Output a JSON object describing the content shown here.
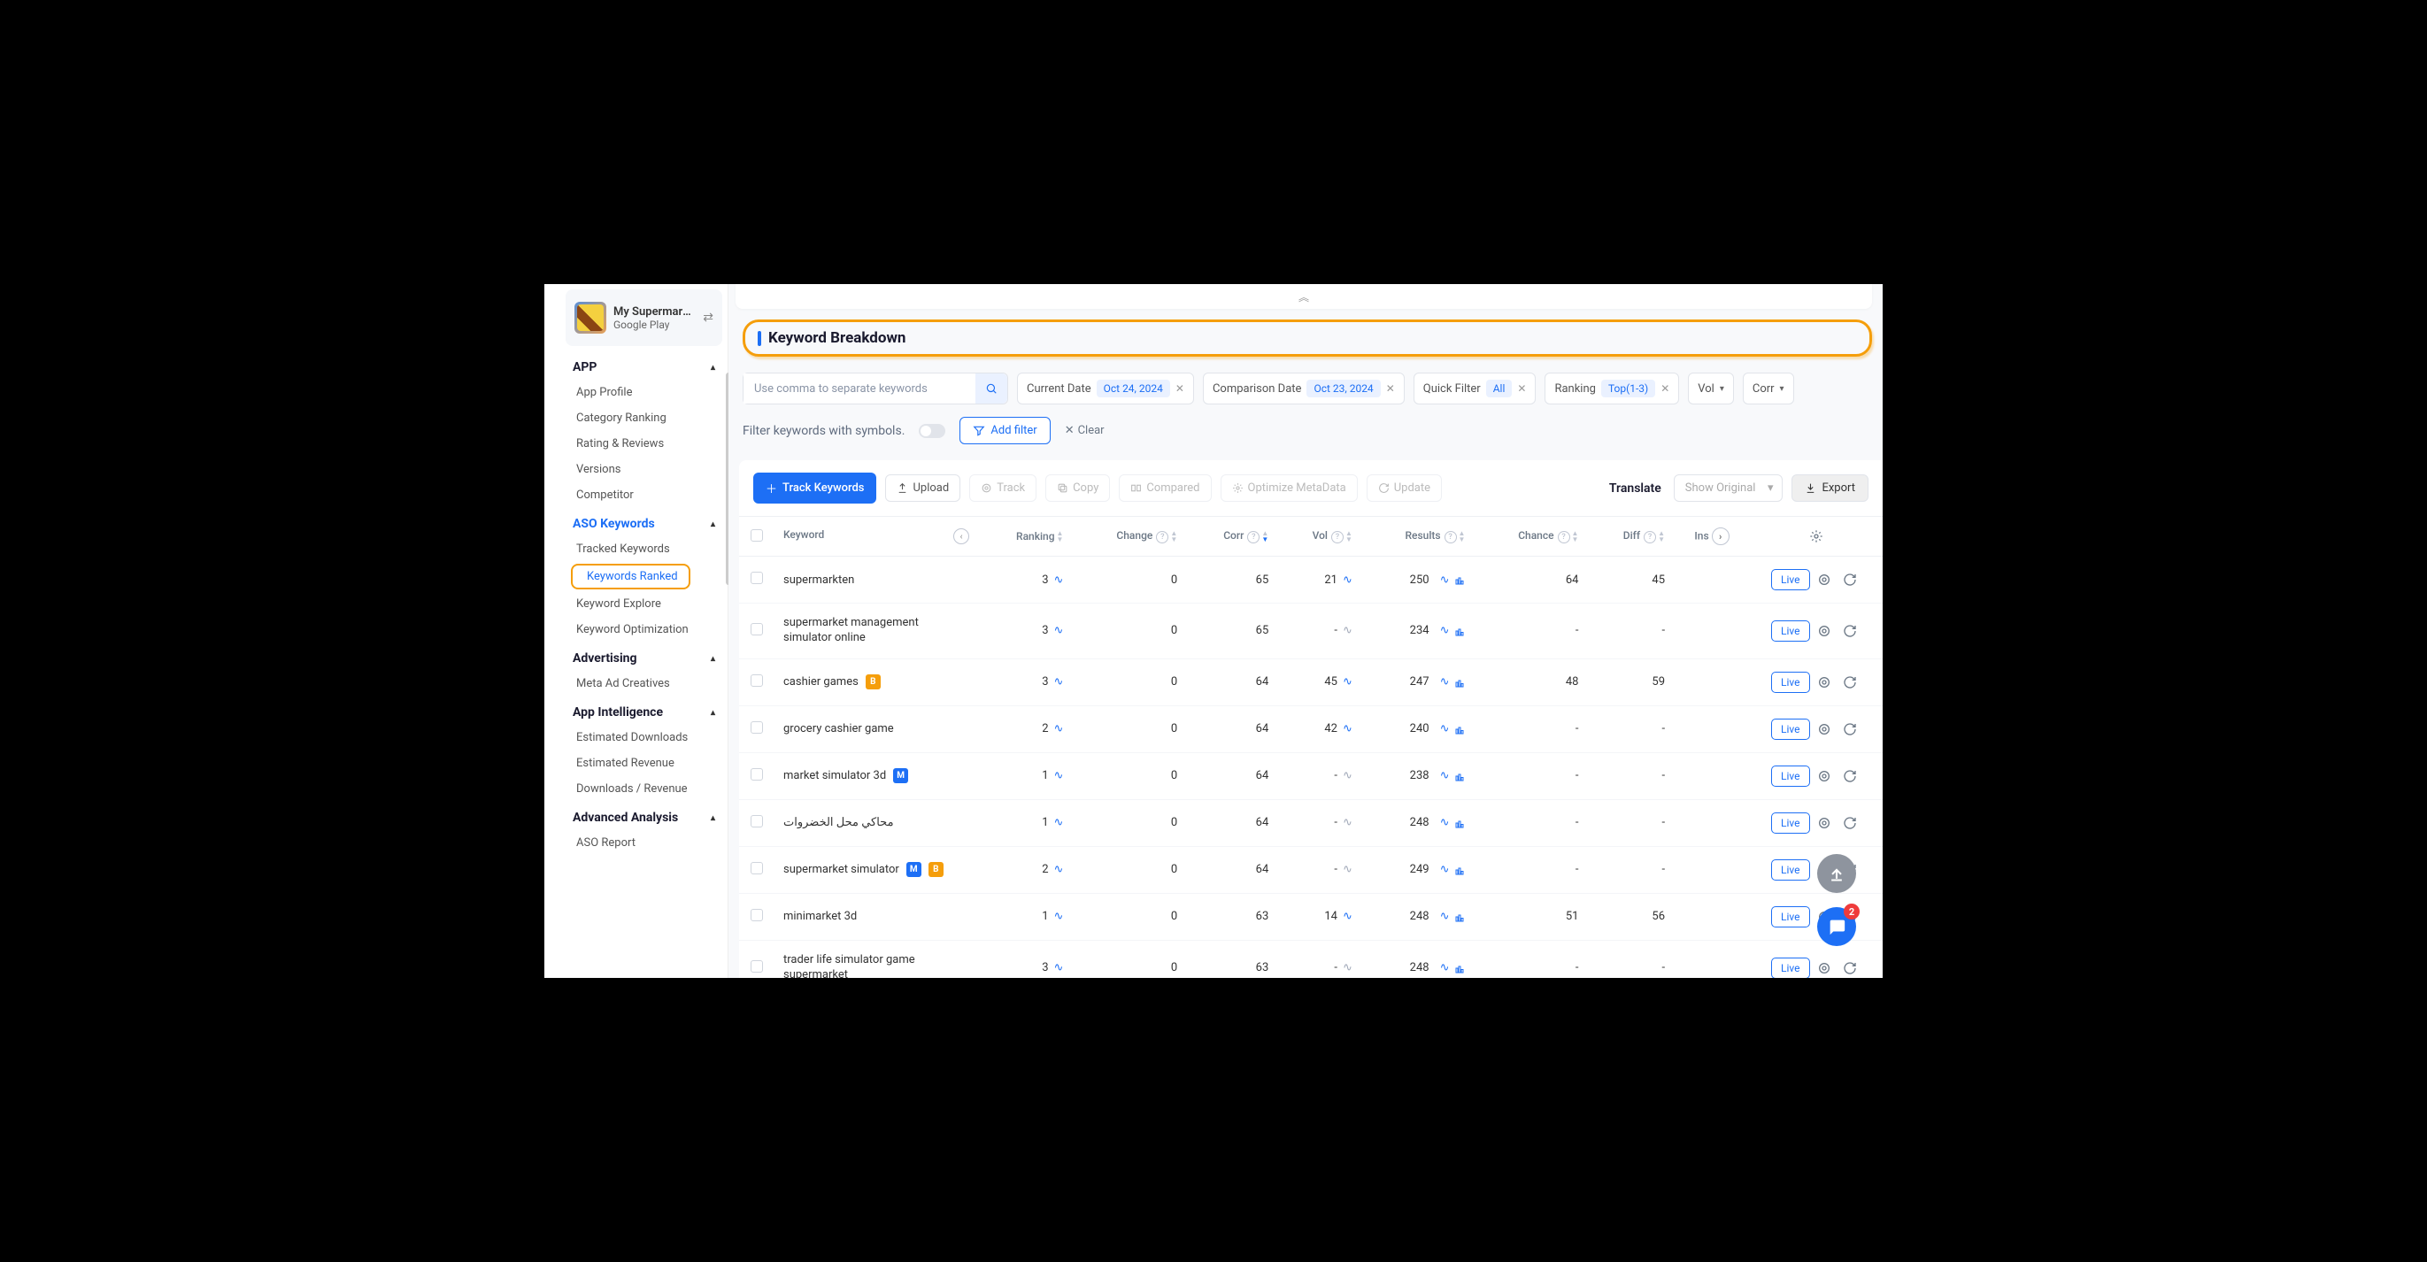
{
  "app_selector": {
    "name": "My Supermark...",
    "store": "Google Play"
  },
  "sidebar": {
    "sections": [
      {
        "title": "APP",
        "items": [
          "App Profile",
          "Category Ranking",
          "Rating & Reviews",
          "Versions",
          "Competitor"
        ]
      },
      {
        "title": "ASO Keywords",
        "active": true,
        "items": [
          "Tracked Keywords",
          "Keywords Ranked",
          "Keyword Explore",
          "Keyword Optimization"
        ],
        "highlighted": 1
      },
      {
        "title": "Advertising",
        "items": [
          "Meta Ad Creatives"
        ]
      },
      {
        "title": "App Intelligence",
        "items": [
          "Estimated Downloads",
          "Estimated Revenue",
          "Downloads / Revenue"
        ]
      },
      {
        "title": "Advanced Analysis",
        "items": [
          "ASO Report"
        ]
      }
    ]
  },
  "page_title": "Keyword Breakdown",
  "filters": {
    "search_placeholder": "Use comma to separate keywords",
    "current_date_label": "Current Date",
    "current_date": "Oct 24, 2024",
    "comparison_date_label": "Comparison Date",
    "comparison_date": "Oct 23, 2024",
    "quick_filter_label": "Quick Filter",
    "quick_filter": "All",
    "ranking_label": "Ranking",
    "ranking": "Top(1-3)",
    "vol_label": "Vol",
    "corr_label": "Corr",
    "symbol_text": "Filter keywords with symbols.",
    "add_filter": "Add filter",
    "clear": "Clear"
  },
  "toolbar": {
    "track": "Track Keywords",
    "upload": "Upload",
    "track2": "Track",
    "copy": "Copy",
    "compared": "Compared",
    "optimize": "Optimize MetaData",
    "update": "Update",
    "translate": "Translate",
    "show_original": "Show Original",
    "export": "Export"
  },
  "columns": [
    "Keyword",
    "Ranking",
    "Change",
    "Corr",
    "Vol",
    "Results",
    "Chance",
    "Diff",
    "Ins"
  ],
  "rows": [
    {
      "keyword": "supermarkten",
      "badges": [],
      "ranking": "3",
      "change": "0",
      "corr": "65",
      "vol": "21",
      "results": "250",
      "chance": "64",
      "diff": "45"
    },
    {
      "keyword": "supermarket management simulator online",
      "badges": [],
      "ranking": "3",
      "change": "0",
      "corr": "65",
      "vol": "-",
      "results": "234",
      "chance": "-",
      "diff": "-"
    },
    {
      "keyword": "cashier games",
      "badges": [
        "B"
      ],
      "ranking": "3",
      "change": "0",
      "corr": "64",
      "vol": "45",
      "results": "247",
      "chance": "48",
      "diff": "59"
    },
    {
      "keyword": "grocery cashier game",
      "badges": [],
      "ranking": "2",
      "change": "0",
      "corr": "64",
      "vol": "42",
      "results": "240",
      "chance": "-",
      "diff": "-"
    },
    {
      "keyword": "market simulator 3d",
      "badges": [
        "M"
      ],
      "ranking": "1",
      "change": "0",
      "corr": "64",
      "vol": "-",
      "results": "238",
      "chance": "-",
      "diff": "-"
    },
    {
      "keyword": "محاكي محل الخضروات",
      "badges": [],
      "ranking": "1",
      "change": "0",
      "corr": "64",
      "vol": "-",
      "results": "248",
      "chance": "-",
      "diff": "-"
    },
    {
      "keyword": "supermarket simulator",
      "badges": [
        "M",
        "B"
      ],
      "ranking": "2",
      "change": "0",
      "corr": "64",
      "vol": "-",
      "results": "249",
      "chance": "-",
      "diff": "-"
    },
    {
      "keyword": "minimarket 3d",
      "badges": [],
      "ranking": "1",
      "change": "0",
      "corr": "63",
      "vol": "14",
      "results": "248",
      "chance": "51",
      "diff": "56"
    },
    {
      "keyword": "trader life simulator game supermarket",
      "badges": [],
      "ranking": "3",
      "change": "0",
      "corr": "63",
      "vol": "-",
      "results": "248",
      "chance": "-",
      "diff": "-"
    }
  ],
  "live_label": "Live",
  "chat_badge": "2"
}
